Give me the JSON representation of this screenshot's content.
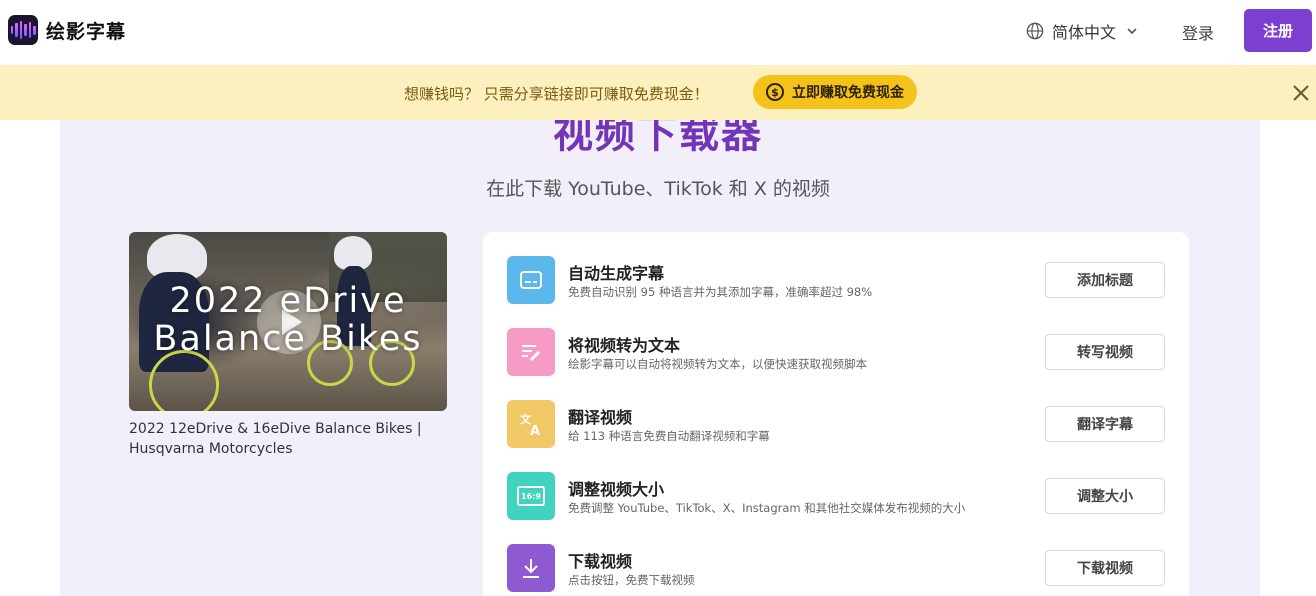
{
  "header": {
    "brand": "绘影字幕",
    "language": "简体中文",
    "login": "登录",
    "signup": "注册"
  },
  "banner": {
    "text": "想赚钱吗？ 只需分享链接即可赚取免费现金！",
    "cta": "立即赚取免费现金",
    "coin_symbol": "$"
  },
  "main": {
    "title": "视频下载器",
    "subtitle": "在此下载 YouTube、TikTok 和 X 的视频"
  },
  "video": {
    "overlay_text": "2022 eDrive Balance Bikes",
    "title": "2022 12eDrive & 16eDive Balance Bikes | Husqvarna Motorcycles"
  },
  "tools": [
    {
      "name": "自动生成字幕",
      "desc": "免费自动识别 95 种语言并为其添加字幕，准确率超过 98%",
      "button": "添加标题",
      "icon": "subtitle-icon",
      "color": "#5cb8ec"
    },
    {
      "name": "将视频转为文本",
      "desc": "绘影字幕可以自动将视频转为文本，以便快速获取视频脚本",
      "button": "转写视频",
      "icon": "transcribe-icon",
      "color": "#f69bc6"
    },
    {
      "name": "翻译视频",
      "desc": "给 113 种语言免费自动翻译视频和字幕",
      "button": "翻译字幕",
      "icon": "translate-icon",
      "color": "#f0c966"
    },
    {
      "name": "调整视频大小",
      "desc": "免费调整 YouTube、TikTok、X、Instagram 和其他社交媒体发布视频的大小",
      "button": "调整大小",
      "icon": "resize-icon",
      "color": "#3fd3c0",
      "icon_label": "16:9"
    },
    {
      "name": "下载视频",
      "desc": "点击按钮，免费下载视频",
      "button": "下载视频",
      "icon": "download-icon",
      "color": "#8e5ad1"
    }
  ]
}
